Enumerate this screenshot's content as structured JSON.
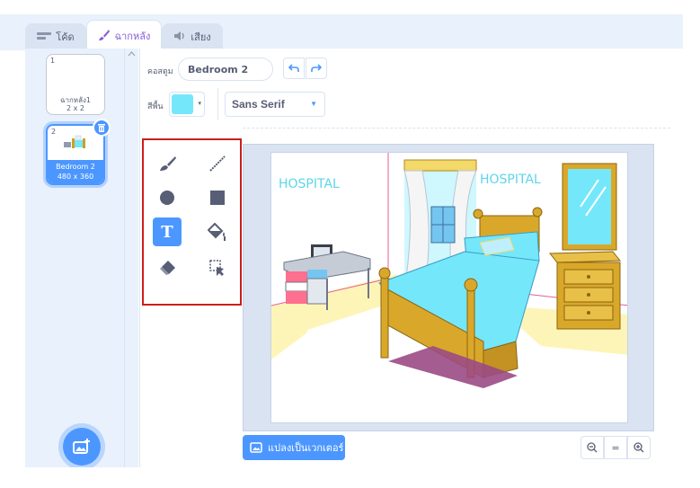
{
  "tabs": [
    {
      "label": "โค้ด",
      "icon": "code-icon",
      "active": false
    },
    {
      "label": "ฉากหลัง",
      "icon": "brush-icon",
      "active": true
    },
    {
      "label": "เสียง",
      "icon": "speaker-icon",
      "active": false
    }
  ],
  "costumes": [
    {
      "num": "1",
      "name": "ฉากหลัง1",
      "size": "2 x 2",
      "selected": false
    },
    {
      "num": "2",
      "name": "Bedroom 2",
      "size": "480 x 360",
      "selected": true
    }
  ],
  "editor": {
    "costume_label": "คอสตูม",
    "costume_name": "Bedroom 2",
    "fill_label": "สีพื้น",
    "fill_color": "#74e7fb",
    "font": "Sans Serif"
  },
  "tools": [
    {
      "name": "brush-tool",
      "icon": "brush-icon",
      "active": false
    },
    {
      "name": "line-tool",
      "icon": "line-icon",
      "active": false
    },
    {
      "name": "circle-tool",
      "icon": "circle-icon",
      "active": false
    },
    {
      "name": "rectangle-tool",
      "icon": "rectangle-icon",
      "active": false
    },
    {
      "name": "text-tool",
      "icon": "text-icon",
      "active": true
    },
    {
      "name": "fill-tool",
      "icon": "paint-bucket-icon",
      "active": false
    },
    {
      "name": "eraser-tool",
      "icon": "eraser-icon",
      "active": false
    },
    {
      "name": "select-tool",
      "icon": "select-icon",
      "active": false
    }
  ],
  "canvas": {
    "left_sign": "HOSPITAL",
    "right_sign": "HOSPITAL"
  },
  "bottom": {
    "convert_label": "แปลงเป็นเวกเตอร์",
    "zoom_out": "-",
    "zoom_reset": "=",
    "zoom_in": "+"
  },
  "colors": {
    "accent": "#4c97ff",
    "highlight_border": "#cc1d1d",
    "active_tab_text": "#855cd6"
  }
}
